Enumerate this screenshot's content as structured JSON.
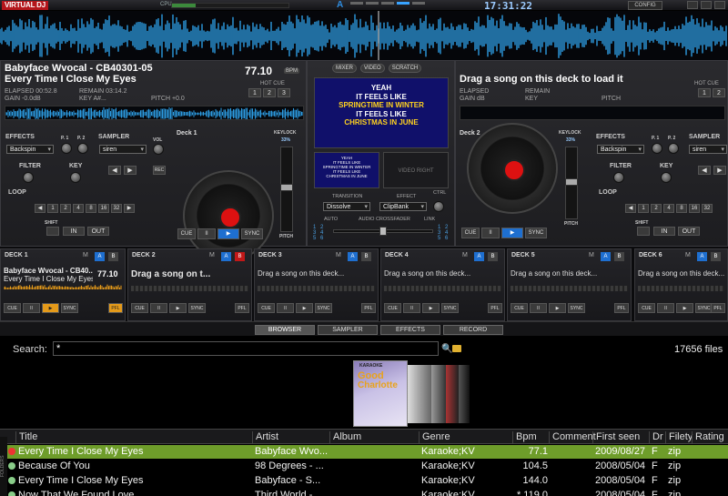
{
  "topbar": {
    "logo": "VIRTUAL DJ",
    "cpu_label": "CPU",
    "cpu_level": 0.2,
    "layout_letter": "A",
    "clock": "17:31:22",
    "config_label": "CONFIG"
  },
  "left_deck": {
    "artist_title": "Babyface Wvocal -  CB40301-05",
    "song": "Every Time I Close My Eyes",
    "bpm": "77.10",
    "bpm_tag": "BPM",
    "elapsed": "ELAPSED 00:52.8",
    "remain": "REMAIN 03:14.2",
    "gain": "GAIN -0.0dB",
    "key": "KEY A#...",
    "pitch": "PITCH +0.0",
    "hot_cue_label": "HOT CUE",
    "hot_cues": [
      "1",
      "2",
      "3"
    ],
    "effects_label": "EFFECTS",
    "effect_value": "Backspin",
    "p1": "P. 1",
    "p2": "P. 2",
    "sampler_label": "SAMPLER",
    "sampler_value": "siren",
    "vol_label": "VOL",
    "rec_label": "REC",
    "filter_label": "FILTER",
    "key_label": "KEY",
    "loop_label": "LOOP",
    "loop_values": [
      "◀",
      "1",
      "2",
      "4",
      "8",
      "16",
      "32",
      "▶"
    ],
    "shift_label": "SHIFT",
    "in_label": "IN",
    "out_label": "OUT",
    "deck_label": "Deck 1",
    "keylock": "KEYLOCK",
    "keylock_pct": "33%",
    "pitch_label": "PITCH",
    "transport": [
      "CUE",
      "II",
      "▶",
      "SYNC"
    ]
  },
  "mixer": {
    "tabs": [
      "MIXER",
      "VIDEO",
      "SCRATCH"
    ],
    "karaoke_lines": [
      {
        "text": "YEAH",
        "color": "white"
      },
      {
        "text": "IT FEELS LIKE",
        "color": "white"
      },
      {
        "text": "SPRINGTIME IN WINTER",
        "color": "yellow"
      },
      {
        "text": "IT FEELS LIKE",
        "color": "white"
      },
      {
        "text": "CHRISTMAS IN JUNE",
        "color": "yellow"
      }
    ],
    "video_right": "VIDEO RIGHT",
    "transition_label": "TRANSITION",
    "transition_value": "Dissolve",
    "effect_label": "EFFECT",
    "effect_value": "ClipBank",
    "ctrl_label": "CTRL",
    "auto_label": "AUTO",
    "crossfader_label": "AUDIO CROSSFADER",
    "link_label": "LINK",
    "channels_left": [
      "1",
      "3",
      "5"
    ],
    "channels_left2": [
      "2",
      "4",
      "6"
    ],
    "channels_right": [
      "1",
      "3",
      "5"
    ],
    "channels_right2": [
      "2",
      "4",
      "6"
    ]
  },
  "right_deck": {
    "empty_message": "Drag a song on this deck to load it",
    "elapsed": "ELAPSED",
    "remain": "REMAIN",
    "gain": "GAIN dB",
    "key": "KEY",
    "pitch": "PITCH",
    "hot_cue_label": "HOT CUE",
    "hot_cues": [
      "1",
      "2"
    ],
    "effects_label": "EFFECTS",
    "effect_value": "Backspin",
    "p1": "P. 1",
    "p2": "P. 2",
    "sampler_label": "SAMPLER",
    "sampler_value": "siren",
    "filter_label": "FILTER",
    "key_label": "KEY",
    "loop_label": "LOOP",
    "loop_values": [
      "◀",
      "1",
      "2",
      "4",
      "8",
      "16",
      "32"
    ],
    "shift_label": "SHIFT",
    "in_label": "IN",
    "out_label": "OUT",
    "deck_label": "Deck 2",
    "keylock": "KEYLOCK",
    "keylock_pct": "33%",
    "pitch_label": "PITCH",
    "transport": [
      "CUE",
      "II",
      "▶",
      "SYNC"
    ]
  },
  "mini_decks": [
    {
      "name": "DECK 1",
      "title": "Babyface Wvocal - CB40...",
      "song": "Every Time I Close My Eyes",
      "bpm": "77.10",
      "loaded": true
    },
    {
      "name": "DECK 2",
      "title": "Drag a song on t...",
      "loaded": false,
      "big": true
    },
    {
      "name": "DECK 3",
      "title": "Drag a song on this deck...",
      "loaded": false
    },
    {
      "name": "DECK 4",
      "title": "Drag a song on this deck...",
      "loaded": false
    },
    {
      "name": "DECK 5",
      "title": "Drag a song on this deck...",
      "loaded": false
    },
    {
      "name": "DECK 6",
      "title": "Drag a song on this deck...",
      "loaded": false
    }
  ],
  "mini_labels": {
    "m": "M",
    "a": "A",
    "b": "B",
    "pfl": "PFL",
    "transport": [
      "CUE",
      "II",
      "▶",
      "SYNC"
    ]
  },
  "browser_tabs": [
    "BROWSER",
    "SAMPLER",
    "EFFECTS",
    "RECORD"
  ],
  "browser": {
    "search_label": "Search:",
    "search_value": "*",
    "file_count": "17656 files",
    "cover_karaoke": "KARAOKE",
    "cover_line1": "Good",
    "cover_line2": "Charlotte",
    "side_tab": "FOLDERS",
    "columns": [
      "Title",
      "Artist",
      "Album",
      "Genre",
      "Bpm",
      "Comment",
      "First seen",
      "Dr",
      "Filety",
      "Rating"
    ],
    "rows": [
      {
        "title": "Every Time I Close My Eyes",
        "artist": "Babyface Wvo...",
        "album": "",
        "genre": "Karaoke;KV",
        "bpm": "77.1",
        "first_seen": "2009/08/27",
        "dr": "F",
        "filetype": "zip",
        "selected": true
      },
      {
        "title": "Because Of You",
        "artist": "98 Degrees - ...",
        "album": "",
        "genre": "Karaoke;KV",
        "bpm": "104.5",
        "first_seen": "2008/05/04",
        "dr": "F",
        "filetype": "zip",
        "selected": false
      },
      {
        "title": "Every Time I Close My Eyes",
        "artist": "Babyface -  S...",
        "album": "",
        "genre": "Karaoke;KV",
        "bpm": "144.0",
        "first_seen": "2008/05/04",
        "dr": "F",
        "filetype": "zip",
        "selected": false
      },
      {
        "title": "Now That We Found Love",
        "artist": "Third World - ...",
        "album": "",
        "genre": "Karaoke;KV",
        "bpm": "* 119.0",
        "first_seen": "2008/05/04",
        "dr": "F",
        "filetype": "zip",
        "selected": false
      }
    ]
  },
  "colors": {
    "accent_blue": "#1e6fd0",
    "waveform": "#2d9be0",
    "selection_green": "#6e9d2a",
    "platter_red": "#dd1111",
    "karaoke_bg": "#10106a"
  }
}
